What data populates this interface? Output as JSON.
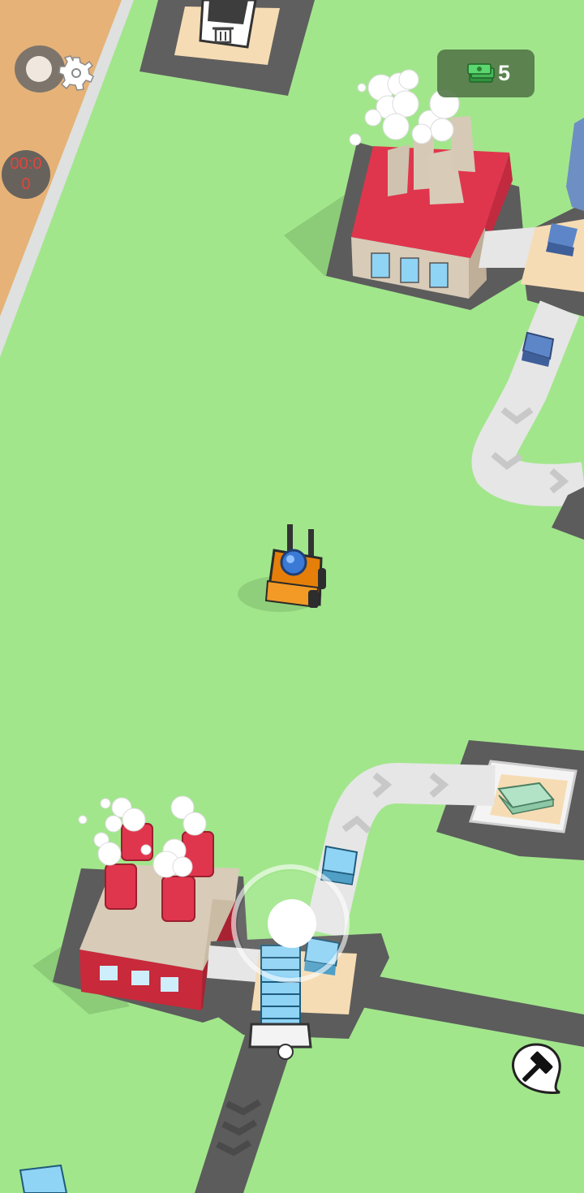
{
  "hud": {
    "money_value": "5",
    "money_icon": "cash-stack-icon",
    "timer_text": "00:00",
    "settings_icon": "gear-icon",
    "toggle_icon": "toggle-switch-icon",
    "build_icon": "hammer-icon"
  },
  "colors": {
    "grass": "#a2e68c",
    "dirt": "#e6b277",
    "road": "#5a5a5a",
    "belt": "#e6e6e6",
    "factory_roof_red": "#e0364d",
    "forklift_orange": "#f28a14",
    "glass_blue": "#7ecbee",
    "money_bg": "#557a4a",
    "timer_red": "#e23a3a"
  }
}
